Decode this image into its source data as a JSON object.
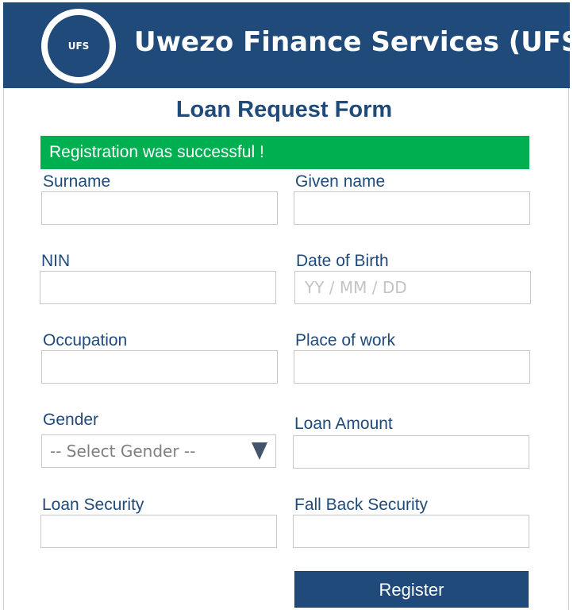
{
  "header": {
    "logo_text": "UFS",
    "company_name": "Uwezo Finance Services (UFS)"
  },
  "form": {
    "title": "Loan Request Form",
    "success_message": "Registration was successful !",
    "fields": {
      "surname": {
        "label": "Surname",
        "value": ""
      },
      "given_name": {
        "label": "Given name",
        "value": ""
      },
      "nin": {
        "label": "NIN",
        "value": ""
      },
      "date_of_birth": {
        "label": "Date of Birth",
        "placeholder": "YY / MM / DD",
        "value": ""
      },
      "occupation": {
        "label": "Occupation",
        "value": ""
      },
      "place_of_work": {
        "label": "Place of work",
        "value": ""
      },
      "gender": {
        "label": "Gender",
        "selected": "-- Select Gender --"
      },
      "loan_amount": {
        "label": "Loan Amount",
        "value": ""
      },
      "loan_security": {
        "label": "Loan Security",
        "value": ""
      },
      "fall_back_security": {
        "label": "Fall Back Security",
        "value": ""
      }
    },
    "register_label": "Register"
  },
  "colors": {
    "brand": "#204a7a",
    "success": "#00b050"
  }
}
